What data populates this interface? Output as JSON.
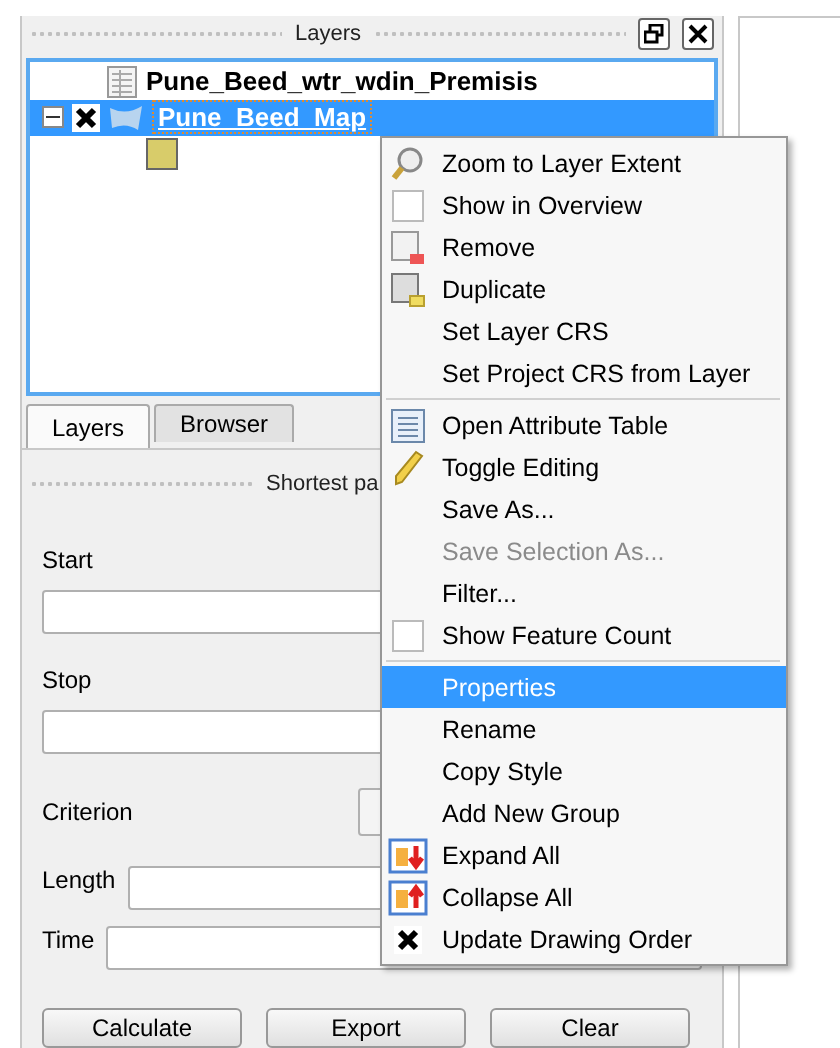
{
  "layers_panel": {
    "title": "Layers",
    "layers": [
      {
        "name": "Pune_Beed_wtr_wdin_Premisis",
        "kind": "table",
        "selected": false
      },
      {
        "name": "Pune_Beed_Map",
        "kind": "polygon",
        "selected": true,
        "expanded": true,
        "visible": true
      }
    ]
  },
  "tabs": [
    {
      "label": "Layers",
      "selected": true
    },
    {
      "label": "Browser",
      "selected": false
    }
  ],
  "shortest_path_panel": {
    "title": "Shortest pa",
    "fields": [
      {
        "label": "Start",
        "kind": "stacked"
      },
      {
        "label": "Stop",
        "kind": "stacked"
      },
      {
        "label": "Criterion",
        "kind": "combo"
      },
      {
        "label": "Length",
        "kind": "inline"
      },
      {
        "label": "Time",
        "kind": "inline"
      }
    ],
    "buttons": [
      "Calculate",
      "Export",
      "Clear"
    ]
  },
  "context_menu": {
    "items": [
      {
        "label": "Zoom to Layer Extent",
        "kind": "zoom",
        "selected": false
      },
      {
        "label": "Show in Overview",
        "kind": "check",
        "checked": false,
        "selected": false
      },
      {
        "label": "Remove",
        "kind": "remove",
        "selected": false
      },
      {
        "label": "Duplicate",
        "kind": "duplicate",
        "selected": false
      },
      {
        "label": "Set Layer CRS",
        "kind": "plain",
        "selected": false
      },
      {
        "label": "Set Project CRS from Layer",
        "kind": "plain",
        "selected": false
      },
      {
        "kind": "separator"
      },
      {
        "label": "Open Attribute Table",
        "kind": "table",
        "selected": false
      },
      {
        "label": "Toggle Editing",
        "kind": "edit",
        "selected": false
      },
      {
        "label": "Save As...",
        "kind": "plain",
        "selected": false
      },
      {
        "label": "Save Selection As...",
        "kind": "plain",
        "disabled": true,
        "selected": false
      },
      {
        "label": "Filter...",
        "kind": "plain",
        "selected": false
      },
      {
        "label": "Show Feature Count",
        "kind": "check",
        "checked": false,
        "selected": false
      },
      {
        "kind": "separator"
      },
      {
        "label": "Properties",
        "kind": "plain",
        "selected": true
      },
      {
        "label": "Rename",
        "kind": "plain",
        "selected": false
      },
      {
        "label": "Copy Style",
        "kind": "plain",
        "selected": false
      },
      {
        "label": "Add New Group",
        "kind": "plain",
        "selected": false
      },
      {
        "label": "Expand All",
        "kind": "expand",
        "selected": false
      },
      {
        "label": "Collapse All",
        "kind": "collapse",
        "selected": false
      },
      {
        "label": "Update Drawing Order",
        "kind": "check",
        "checked": true,
        "selected": false
      }
    ]
  }
}
